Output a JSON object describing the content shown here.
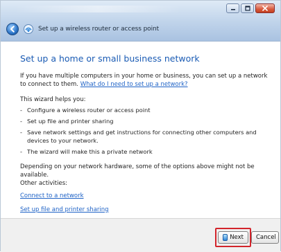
{
  "window": {
    "title": "Set up a wireless router or access point"
  },
  "content": {
    "heading": "Set up a home or small business network",
    "intro_text": "If you have multiple computers in your home or business, you can set up a network to connect to them.",
    "intro_link": "What do I need to set up a network?",
    "helps_label": "This wizard helps you:",
    "helps_items": [
      "Configure a wireless router or access point",
      "Set up file and printer sharing",
      "Save network settings and get instructions for connecting other computers and devices to your network.",
      "The wizard will make this a private network"
    ],
    "availability_text": "Depending on your network hardware, some of the options above might not be available.",
    "other_activities_label": "Other activities:",
    "other_links": [
      "Connect to a network",
      "Set up file and printer sharing"
    ]
  },
  "footer": {
    "next_label": "Next",
    "cancel_label": "Cancel"
  },
  "icons": {
    "back": "back-arrow-icon",
    "wizard": "wireless-network-icon",
    "minimize": "minimize-icon",
    "maximize": "maximize-icon",
    "close": "close-icon",
    "next": "next-arrow-icon"
  },
  "colors": {
    "heading_blue": "#1a5bb4",
    "link_blue": "#1e62c6",
    "highlight_red": "#d3242b"
  }
}
